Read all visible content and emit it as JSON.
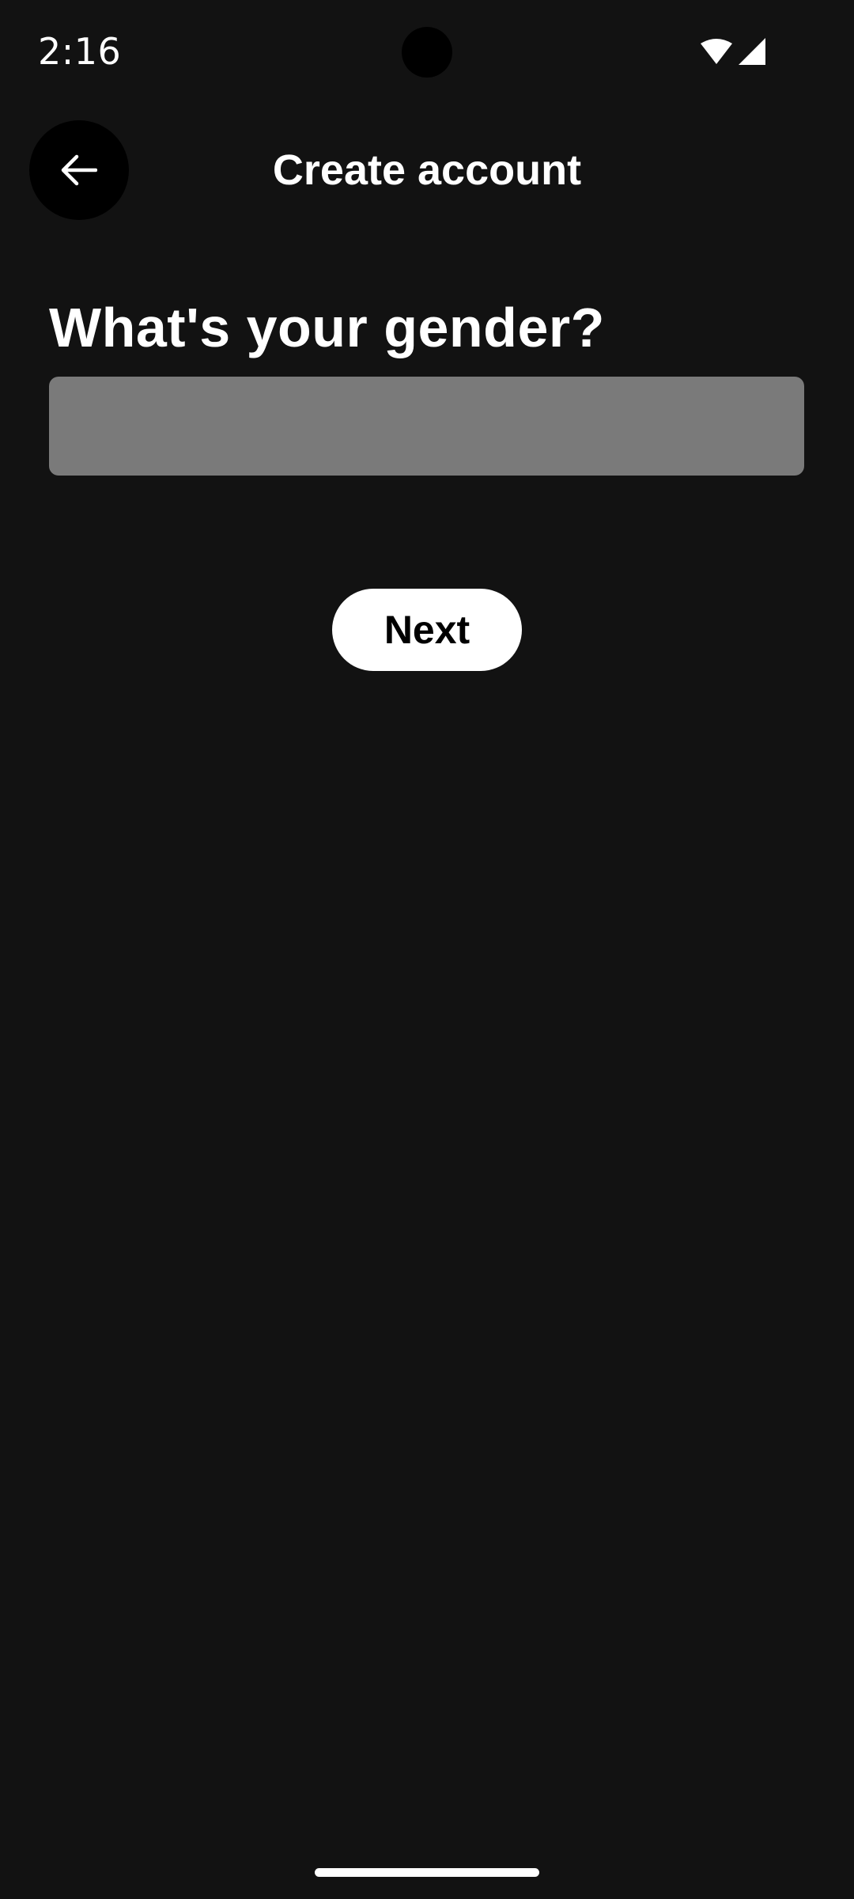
{
  "status_bar": {
    "time": "2:16",
    "icons": [
      "wifi-icon",
      "cellular-signal-icon"
    ]
  },
  "app_bar": {
    "back_icon": "arrow-left-icon",
    "title": "Create account"
  },
  "form": {
    "question": "What's your gender?",
    "gender_value": "",
    "next_label": "Next"
  },
  "colors": {
    "background": "#121212",
    "field": "#7a7a7a",
    "button": "#ffffff",
    "button_text": "#000000"
  }
}
